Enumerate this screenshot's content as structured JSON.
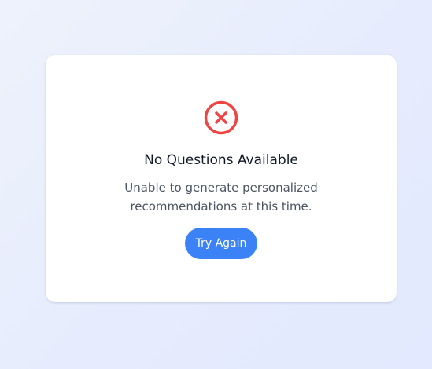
{
  "empty_state": {
    "icon": "x-circle-icon",
    "icon_color": "#ef4444",
    "title": "No Questions Available",
    "message_line1": "Unable to generate personalized",
    "message_line2": "recommendations at this time.",
    "button_label": "Try Again",
    "button_color": "#3b82f6"
  }
}
